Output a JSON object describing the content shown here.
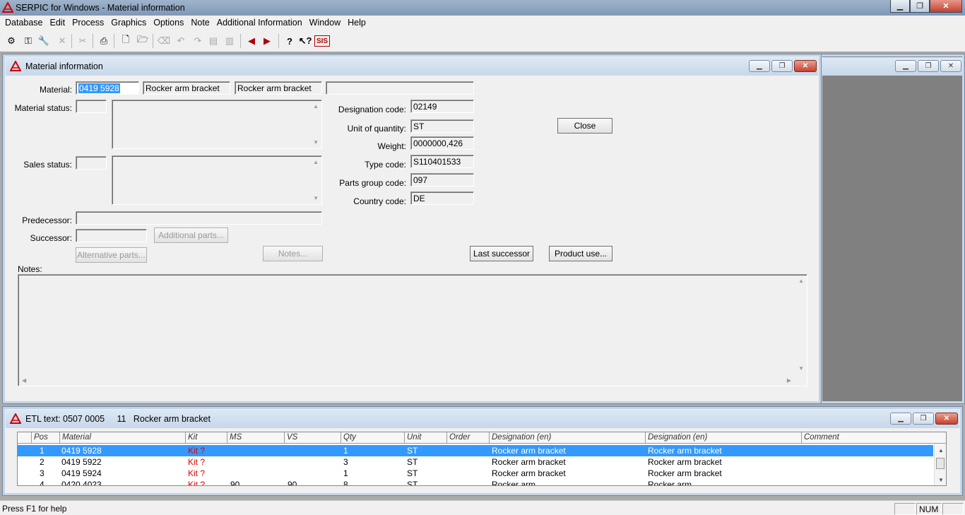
{
  "app": {
    "title": "SERPIC for Windows - Material information",
    "window_buttons": {
      "minimize": "▁",
      "maximize": "❐",
      "close": "✕"
    }
  },
  "menu": [
    "Database",
    "Edit",
    "Process",
    "Graphics",
    "Options",
    "Note",
    "Additional Information",
    "Window",
    "Help"
  ],
  "toolbar": {
    "sis_label": "SIS"
  },
  "material_window": {
    "title": "Material information",
    "labels": {
      "material": "Material:",
      "material_status": "Material status:",
      "sales_status": "Sales status:",
      "predecessor": "Predecessor:",
      "successor": "Successor:",
      "designation_code": "Designation code:",
      "unit_of_quantity": "Unit of quantity:",
      "weight": "Weight:",
      "type_code": "Type code:",
      "parts_group_code": "Parts group code:",
      "country_code": "Country code:",
      "notes": "Notes:"
    },
    "values": {
      "material": "0419 5928",
      "designation_1": "Rocker arm bracket",
      "designation_2": "Rocker arm bracket",
      "designation_code": "02149",
      "unit_of_quantity": "ST",
      "weight": "0000000,426",
      "type_code": "S110401533",
      "parts_group_code": "097",
      "country_code": "DE"
    },
    "buttons": {
      "close": "Close",
      "additional_parts": "Additional parts...",
      "alternative_parts": "Alternative parts...",
      "notes": "Notes...",
      "last_successor": "Last successor",
      "product_use": "Product use..."
    }
  },
  "etl_window": {
    "title": "ETL text: 0507 0005     11   Rocker arm bracket",
    "columns": [
      "Pos",
      "Material",
      "Kit",
      "MS",
      "VS",
      "Qty",
      "Unit",
      "Order",
      "Designation (en)",
      "Designation (en)",
      "Comment"
    ],
    "rows": [
      {
        "pos": "1",
        "material": "0419 5928",
        "kit": "Kit ?",
        "ms": "",
        "vs": "",
        "qty": "1",
        "unit": "ST",
        "order": "",
        "des1": "Rocker arm bracket",
        "des2": "Rocker arm bracket",
        "comment": ""
      },
      {
        "pos": "2",
        "material": "0419 5922",
        "kit": "Kit ?",
        "ms": "",
        "vs": "",
        "qty": "3",
        "unit": "ST",
        "order": "",
        "des1": "Rocker arm bracket",
        "des2": "Rocker arm bracket",
        "comment": ""
      },
      {
        "pos": "3",
        "material": "0419 5924",
        "kit": "Kit ?",
        "ms": "",
        "vs": "",
        "qty": "1",
        "unit": "ST",
        "order": "",
        "des1": "Rocker arm bracket",
        "des2": "Rocker arm bracket",
        "comment": ""
      },
      {
        "pos": "4",
        "material": "0420 4023",
        "kit": "Kit ?",
        "ms": "90",
        "vs": "90",
        "qty": "8",
        "unit": "ST",
        "order": "",
        "des1": "Rocker arm",
        "des2": "Rocker arm",
        "comment": ""
      }
    ]
  },
  "status": {
    "message": "Press F1 for help",
    "num": "NUM"
  }
}
